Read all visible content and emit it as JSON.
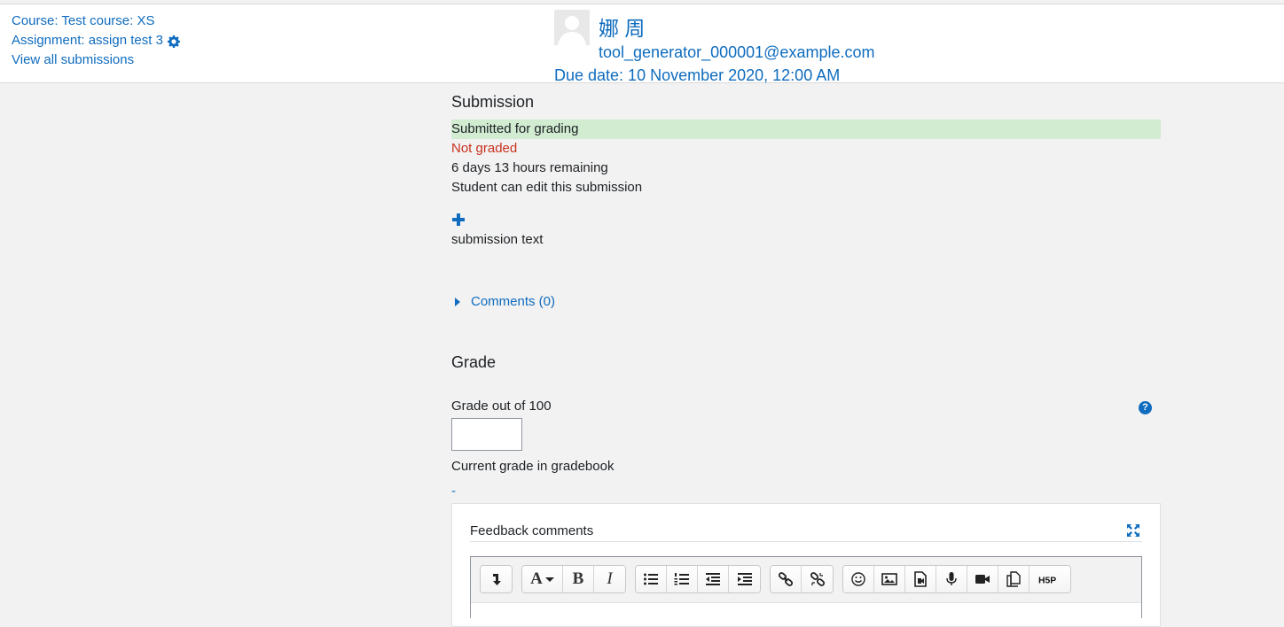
{
  "header": {
    "course_link": "Course: Test course: XS",
    "assignment_link": "Assignment: assign test 3",
    "view_all_link": "View all submissions",
    "user_name": "娜 周",
    "user_email": "tool_generator_000001@example.com",
    "due_date": "Due date: 10 November 2020, 12:00 AM"
  },
  "submission": {
    "title": "Submission",
    "status_submitted": "Submitted for grading",
    "status_grading": "Not graded",
    "time_remaining": "6 days 13 hours remaining",
    "edit_status": "Student can edit this submission",
    "submission_text": "submission text",
    "comments_toggle": "Comments (0)"
  },
  "grade": {
    "title": "Grade",
    "grade_label": "Grade out of 100",
    "grade_value": "",
    "current_grade_label": "Current grade in gradebook",
    "current_grade_value": "-"
  },
  "feedback": {
    "label": "Feedback comments",
    "toolbar_groups": [
      [
        "collapse-icon"
      ],
      [
        "font-style-icon",
        "bold-icon",
        "italic-icon"
      ],
      [
        "bullet-list-icon",
        "numbered-list-icon",
        "outdent-icon",
        "indent-icon"
      ],
      [
        "link-icon",
        "unlink-icon"
      ],
      [
        "emoji-icon",
        "image-icon",
        "media-icon",
        "audio-icon",
        "video-icon",
        "manage-files-icon",
        "h5p-icon"
      ]
    ]
  },
  "colors": {
    "link": "#0f6cbf",
    "submitted_bg": "#d2ecd1",
    "not_graded": "#ca3120",
    "page_bg": "#f2f2f2"
  }
}
